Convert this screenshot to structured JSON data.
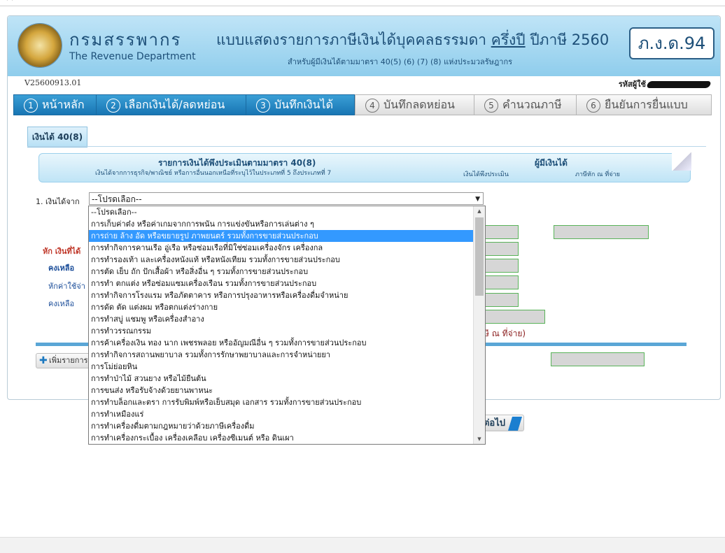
{
  "header": {
    "org_th": "กรมสรรพากร",
    "org_en": "The Revenue Department",
    "form_title_a": "แบบแสดงรายการภาษีเงินได้บุคคลธรรมดา",
    "form_title_b": "ครึ่งปี",
    "form_title_c": "ปีภาษี 2560",
    "form_subtitle": "สำหรับผู้มีเงินได้ตามมาตรา 40(5) (6) (7) (8) แห่งประมวลรัษฎากร",
    "form_code": "ภ.ง.ด.94"
  },
  "version": "V25600913.01",
  "user_label": "รหัสผู้ใช้",
  "steps": [
    {
      "num": "1",
      "label": "หน้าหลัก",
      "state": "done"
    },
    {
      "num": "2",
      "label": "เลือกเงินได้/ลดหย่อน",
      "state": "done"
    },
    {
      "num": "3",
      "label": "บันทึกเงินได้",
      "state": "done"
    },
    {
      "num": "4",
      "label": "บันทึกลดหย่อน",
      "state": "todo"
    },
    {
      "num": "5",
      "label": "คำนวณภาษี",
      "state": "todo"
    },
    {
      "num": "6",
      "label": "ยืนยันการยื่นแบบ",
      "state": "todo"
    }
  ],
  "tab_label": "เงินได้ 40(8)",
  "banner": {
    "title": "รายการเงินได้พึงประเมินตามมาตรา 40(8)",
    "subtitle": "เงินได้จากการธุรกิจ/พาณิชย์ หรือการอื่นนอกเหนือที่ระบุไว้ในประเภทที่ 5 ถึงประเภทที่ 7",
    "payer": "ผู้มีเงินได้",
    "col_income": "เงินได้พึงประเมิน",
    "col_tax": "ภาษีหัก ณ ที่จ่าย"
  },
  "form": {
    "income_from_label": "1. เงินได้จาก",
    "select_value": "--โปรดเลือก--",
    "deduct_label": "หัก เงินที่ได้",
    "remaining_label": "คงเหลือ",
    "expense_label": "หักค่าใช้จ่า",
    "remaining_label2": "คงเหลือ",
    "tax_note": "ษี ณ ที่จ่าย)",
    "add_button": "เพิ่มรายการ",
    "next_button": "ต่อไป"
  },
  "dropdown_options": [
    "--โปรดเลือก--",
    "การเก็บค่าต๋ง หรือค่าเกมจากการพนัน การแข่งขันหรือการเล่นต่าง ๆ",
    "การถ่าย ล้าง อัด หรือขยายรูป ภาพยนตร์ รวมทั้งการขายส่วนประกอบ",
    "การทำกิจการคานเรือ อู่เรือ หรือซ่อมเรือที่มิใช่ซ่อมเครื่องจักร เครื่องกล",
    "การทำรองเท้า และเครื่องหนังแท้ หรือหนังเทียม รวมทั้งการขายส่วนประกอบ",
    "การตัด เย็บ ถัก ปักเสื้อผ้า หรือสิ่งอื่น ๆ รวมทั้งการขายส่วนประกอบ",
    "การทำ ตกแต่ง หรือซ่อมแซมเครื่องเรือน รวมทั้งการขายส่วนประกอบ",
    "การทำกิจการโรงแรม หรือภัตตาคาร หรือการปรุงอาหารหรือเครื่องดื่มจำหน่าย",
    "การดัด ตัด แต่งผม หรือตกแต่งร่างกาย",
    "การทำสบู่ แชมพู หรือเครื่องสำอาง",
    "การทำวรรณกรรม",
    "การค้าเครื่องเงิน ทอง นาก เพชรพลอย หรืออัญมณีอื่น ๆ รวมทั้งการขายส่วนประกอบ",
    "การทำกิจการสถานพยาบาล รวมทั้งการรักษาพยาบาลและการจำหน่ายยา",
    "การโม่ย่อยหิน",
    "การทำป่าไม้ สวนยาง หรือไม้ยืนต้น",
    "การขนส่ง หรือรับจ้างด้วยยานพาหนะ",
    "การทำบล็อกและตรา การรับพิมพ์หรือเย็บสมุด เอกสาร รวมทั้งการขายส่วนประกอบ",
    "การทำเหมืองแร่",
    "การทำเครื่องดื่มตามกฎหมายว่าด้วยภาษีเครื่องดื่ม",
    "การทำเครื่องกระเบื้อง เครื่องเคลือบ เครื่องซีเมนต์ หรือ ดินเผา"
  ],
  "selected_option_index": 2,
  "colors": {
    "header_blue": "#8fcdec",
    "step_active": "#1875b3",
    "highlight": "#3399ff",
    "field_border": "#59b359"
  }
}
